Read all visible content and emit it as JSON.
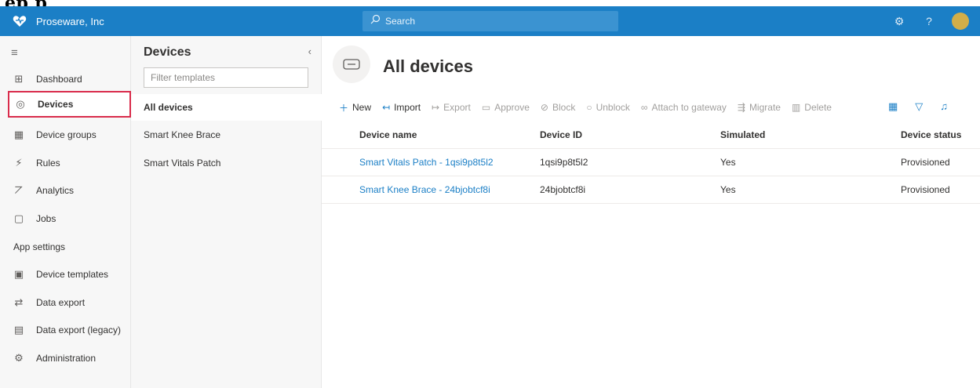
{
  "top_fragment": "ep   p",
  "topbar": {
    "brand": "Proseware, Inc",
    "search_placeholder": "Search",
    "accent": "#1b7fc6"
  },
  "nav": {
    "items": [
      {
        "label": "Dashboard",
        "icon": "dashboard-icon",
        "glyph": "⊞"
      },
      {
        "label": "Devices",
        "icon": "devices-icon",
        "glyph": "◎",
        "active": true
      },
      {
        "label": "Device groups",
        "icon": "device-groups-icon",
        "glyph": "▦"
      },
      {
        "label": "Rules",
        "icon": "rules-icon",
        "glyph": "⚡"
      },
      {
        "label": "Analytics",
        "icon": "analytics-icon",
        "glyph": "⦢"
      },
      {
        "label": "Jobs",
        "icon": "jobs-icon",
        "glyph": "▢"
      }
    ],
    "section_label": "App settings",
    "settings_items": [
      {
        "label": "Device templates",
        "icon": "device-templates-icon",
        "glyph": "▣"
      },
      {
        "label": "Data export",
        "icon": "data-export-icon",
        "glyph": "⇄"
      },
      {
        "label": "Data export (legacy)",
        "icon": "data-export-legacy-icon",
        "glyph": "▤"
      },
      {
        "label": "Administration",
        "icon": "administration-icon",
        "glyph": "⚙"
      }
    ]
  },
  "subpanel": {
    "title": "Devices",
    "filter_placeholder": "Filter templates",
    "items": [
      "All devices",
      "Smart Knee Brace",
      "Smart Vitals Patch"
    ]
  },
  "main": {
    "title": "All devices",
    "toolbar": [
      {
        "label": "New",
        "glyph": "+",
        "enabled": true
      },
      {
        "label": "Import",
        "glyph": "↤",
        "enabled": true
      },
      {
        "label": "Export",
        "glyph": "↦",
        "enabled": false
      },
      {
        "label": "Approve",
        "glyph": "▭",
        "enabled": false
      },
      {
        "label": "Block",
        "glyph": "⊘",
        "enabled": false
      },
      {
        "label": "Unblock",
        "glyph": "○",
        "enabled": false
      },
      {
        "label": "Attach to gateway",
        "glyph": "∞",
        "enabled": false
      },
      {
        "label": "Migrate",
        "glyph": "⇶",
        "enabled": false
      },
      {
        "label": "Delete",
        "glyph": "▥",
        "enabled": false
      }
    ],
    "columns": [
      "Device name",
      "Device ID",
      "Simulated",
      "Device status"
    ],
    "rows": [
      [
        "Smart Vitals Patch - 1qsi9p8t5l2",
        "1qsi9p8t5l2",
        "Yes",
        "Provisioned"
      ],
      [
        "Smart Knee Brace - 24bjobtcf8i",
        "24bjobtcf8i",
        "Yes",
        "Provisioned"
      ]
    ]
  }
}
